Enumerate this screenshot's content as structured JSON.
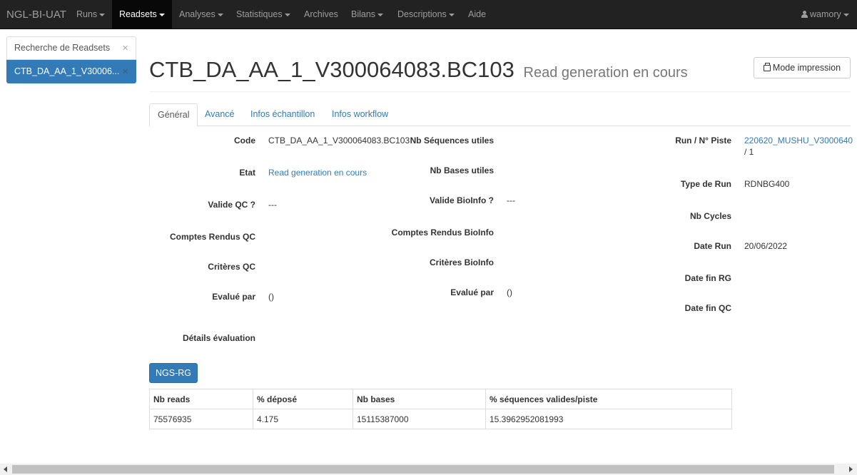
{
  "navbar": {
    "brand": "NGL-BI-UAT",
    "items": [
      {
        "label": "Runs"
      },
      {
        "label": "Readsets"
      },
      {
        "label": "Analyses"
      },
      {
        "label": "Statistiques"
      },
      {
        "label": "Archives"
      },
      {
        "label": "Bilans"
      },
      {
        "label": "Descriptions"
      },
      {
        "label": "Aide"
      }
    ],
    "user": "wamory"
  },
  "sidebar": {
    "items": [
      {
        "label": "Recherche de Readsets",
        "close": "×"
      },
      {
        "label": "CTB_DA_AA_1_V30006...",
        "close": "×"
      }
    ]
  },
  "header": {
    "title": "CTB_DA_AA_1_V300064083.BC103",
    "subtitle": "Read generation en cours",
    "print_button": "Mode impression"
  },
  "tabs": [
    {
      "label": "Général"
    },
    {
      "label": "Avancé"
    },
    {
      "label": "Infos échantillon"
    },
    {
      "label": "Infos workflow"
    }
  ],
  "fields": {
    "code": {
      "label": "Code",
      "value": "CTB_DA_AA_1_V300064083.BC103"
    },
    "etat": {
      "label": "Etat",
      "value": "Read generation en cours"
    },
    "valide_qc": {
      "label": "Valide QC ?",
      "value": "---"
    },
    "comptes_rendus_qc": {
      "label": "Comptes Rendus QC"
    },
    "criteres_qc": {
      "label": "Critères QC"
    },
    "evalue_par_qc": {
      "label": "Evalué par",
      "value": "()"
    },
    "details_evaluation": {
      "label": "Détails évaluation"
    },
    "nb_sequences_utiles": {
      "label": "Nb Séquences utiles"
    },
    "nb_bases_utiles": {
      "label": "Nb Bases utiles"
    },
    "valide_bioinfo": {
      "label": "Valide BioInfo ?",
      "value": "---"
    },
    "comptes_rendus_bioinfo": {
      "label": "Comptes Rendus BioInfo"
    },
    "criteres_bioinfo": {
      "label": "Critères BioInfo"
    },
    "evalue_par_bioinfo": {
      "label": "Evalué par",
      "value": "()"
    },
    "run_piste": {
      "label": "Run / N° Piste",
      "value": "220620_MUSHU_V3000640",
      "value2": "/ 1"
    },
    "type_run": {
      "label": "Type de Run",
      "value": "RDNBG400"
    },
    "nb_cycles": {
      "label": "Nb Cycles"
    },
    "date_run": {
      "label": "Date Run",
      "value": "20/06/2022"
    },
    "date_fin_rg": {
      "label": "Date fin RG"
    },
    "date_fin_qc": {
      "label": "Date fin QC"
    }
  },
  "ngs_button": "NGS-RG",
  "table": {
    "headers": [
      "Nb reads",
      "% déposé",
      "Nb bases",
      "% séquences valides/piste"
    ],
    "rows": [
      [
        "75576935",
        "4.175",
        "15115387000",
        "15.3962952081993"
      ]
    ]
  }
}
